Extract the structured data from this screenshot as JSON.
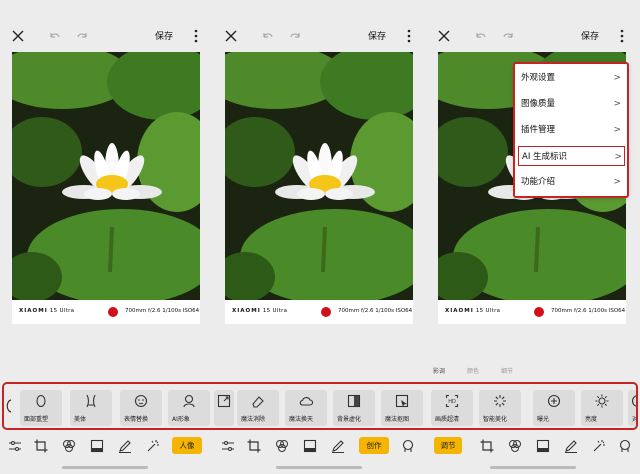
{
  "header": {
    "save_label": "保存"
  },
  "photo": {
    "brand": "XIAOMI",
    "model": "15 Ultra",
    "params": "700mm  f/2.6  1/100s  ISO64"
  },
  "menu": {
    "items": [
      {
        "label": "外观设置"
      },
      {
        "label": "图像质量"
      },
      {
        "label": "插件管理"
      },
      {
        "label": "AI 生成标识"
      },
      {
        "label": "功能介绍"
      }
    ]
  },
  "screen3_tabs": [
    "影调",
    "颜色",
    "细节"
  ],
  "tools": [
    {
      "label": "面部重塑",
      "icon": "face-reshape-icon"
    },
    {
      "label": "美体",
      "icon": "body-shape-icon"
    },
    {
      "label": "表情替换",
      "icon": "expression-swap-icon"
    },
    {
      "label": "AI形象",
      "icon": "ai-portrait-icon"
    },
    {
      "label": "",
      "icon": "expand-icon"
    },
    {
      "label": "魔法消除",
      "icon": "eraser-icon"
    },
    {
      "label": "魔法换天",
      "icon": "cloud-icon"
    },
    {
      "label": "背景虚化",
      "icon": "blur-icon"
    },
    {
      "label": "魔法抠图",
      "icon": "cutout-icon"
    },
    {
      "label": "画质超清",
      "icon": "hd-icon"
    },
    {
      "label": "智能美化",
      "icon": "auto-enhance-icon"
    },
    {
      "label": "曝光",
      "icon": "exposure-icon"
    },
    {
      "label": "亮度",
      "icon": "brightness-icon"
    },
    {
      "label": "对",
      "icon": "contrast-icon"
    }
  ],
  "nav": {
    "pill1": "人像",
    "pill2": "创作",
    "pill3": "调节"
  }
}
